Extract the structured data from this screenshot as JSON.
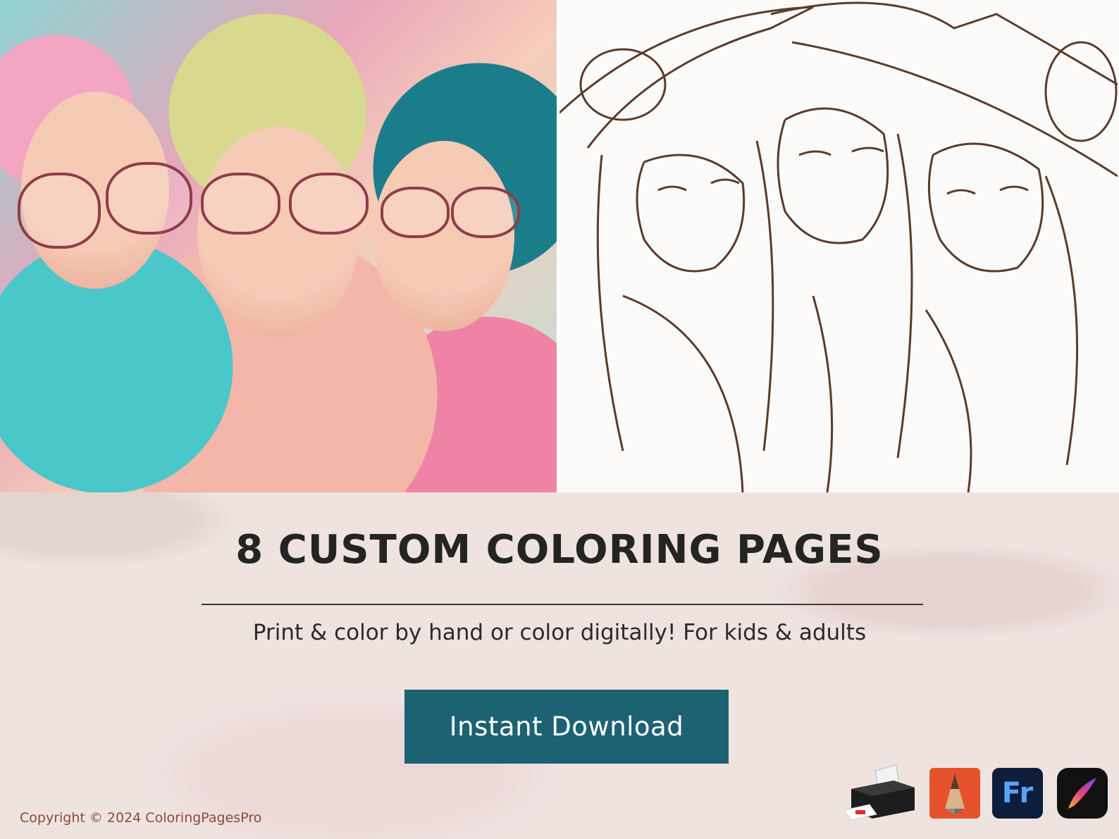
{
  "hero": {
    "left_image": "colorful-illustration-three-girls",
    "right_image": "line-art-coloring-page-three-girls"
  },
  "title": "8 CUSTOM COLORING PAGES",
  "subtitle": "Print & color by hand or color digitally! For kids & adults",
  "cta": {
    "label": "Instant Download"
  },
  "copyright": "Copyright © 2024 ColoringPagesPro",
  "apps": {
    "icons": [
      "printer-icon",
      "sketchbook-pencil-icon",
      "adobe-fresco-icon",
      "procreate-icon"
    ],
    "fresco_label": "Fr"
  },
  "colors": {
    "accent": "#1d6272",
    "title": "#242523",
    "copyright": "#8b4a3a",
    "background": "#efe3e0"
  }
}
